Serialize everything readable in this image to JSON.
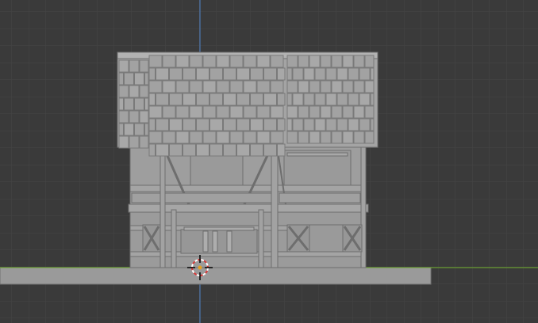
{
  "viewport": {
    "background": "#3a3a3a",
    "grid_minor_color": "#444444",
    "grid_major_color": "#4c4c4c",
    "axis_x_color": "#6fae2a",
    "axis_z_color": "#4f82c6",
    "view": "front-orthographic"
  },
  "model": {
    "object": "medieval-timber-frame-house",
    "base_color": "#9b9b9b",
    "roof_color": "#a4a4a4",
    "edge_color": "#6e6e6e",
    "ground_color": "#9a9a9a"
  },
  "cursor": {
    "icon": "3d-cursor-icon",
    "ring_color_1": "#d63a3a",
    "ring_color_2": "#ffffff"
  }
}
